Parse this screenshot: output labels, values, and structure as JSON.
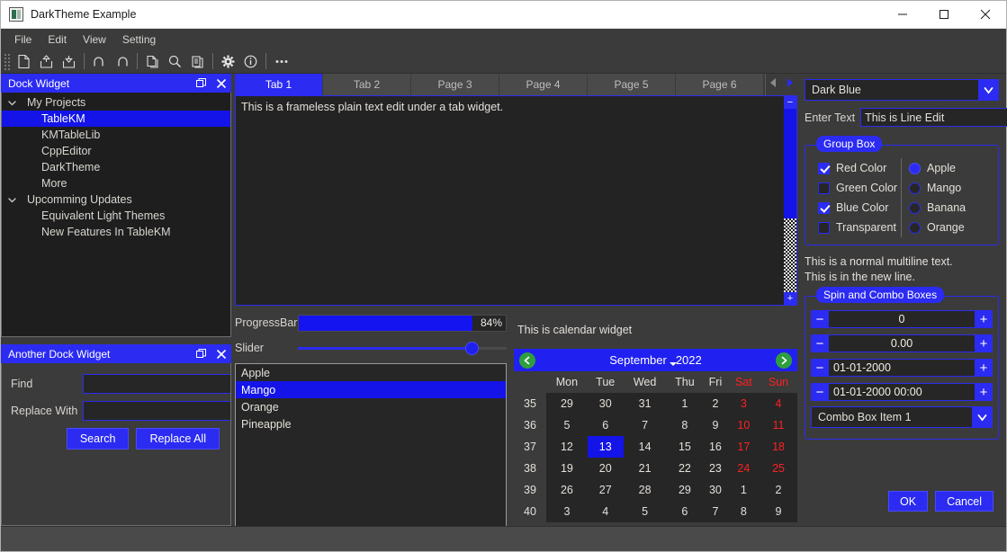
{
  "window": {
    "title": "DarkTheme Example",
    "minimize_label": "minimize",
    "maximize_label": "maximize",
    "close_label": "close"
  },
  "menubar": {
    "items": [
      {
        "label": "File"
      },
      {
        "label": "Edit"
      },
      {
        "label": "View"
      },
      {
        "label": "Setting"
      }
    ]
  },
  "toolbar": {
    "icons": [
      {
        "name": "new-file-icon"
      },
      {
        "name": "upload-icon"
      },
      {
        "name": "download-icon"
      },
      {
        "name": "undo-icon"
      },
      {
        "name": "redo-icon"
      },
      {
        "name": "copy-icon"
      },
      {
        "name": "search-icon"
      },
      {
        "name": "paste-icon"
      },
      {
        "name": "gear-icon"
      },
      {
        "name": "info-icon"
      },
      {
        "name": "overflow-icon",
        "label": "●●●"
      }
    ]
  },
  "dock1": {
    "title": "Dock Widget",
    "tree": [
      {
        "label": "My Projects",
        "level": 0,
        "expanded": true,
        "selected": false
      },
      {
        "label": "TableKM",
        "level": 1,
        "selected": true
      },
      {
        "label": "KMTableLib",
        "level": 1,
        "selected": false
      },
      {
        "label": "CppEditor",
        "level": 1,
        "selected": false
      },
      {
        "label": "DarkTheme",
        "level": 1,
        "selected": false
      },
      {
        "label": "More",
        "level": 1,
        "selected": false
      },
      {
        "label": "Upcomming Updates",
        "level": 0,
        "expanded": true,
        "selected": false
      },
      {
        "label": "Equivalent Light Themes",
        "level": 1,
        "selected": false
      },
      {
        "label": "New Features In TableKM",
        "level": 1,
        "selected": false
      }
    ]
  },
  "dock2": {
    "title": "Another Dock Widget",
    "find_label": "Find",
    "find_value": "",
    "replace_label": "Replace With",
    "replace_value": "",
    "search_button": "Search",
    "replace_all_button": "Replace All"
  },
  "tabs": {
    "items": [
      {
        "label": "Tab 1",
        "active": true
      },
      {
        "label": "Tab 2",
        "active": false
      },
      {
        "label": "Page 3",
        "active": false
      },
      {
        "label": "Page 4",
        "active": false
      },
      {
        "label": "Page 5",
        "active": false
      },
      {
        "label": "Page 6",
        "active": false
      }
    ],
    "nav_prev": "◀",
    "nav_next": "▶"
  },
  "editor": {
    "text": "This is a frameless plain text edit under a tab widget.",
    "scroll_up_label": "−",
    "scroll_down_label": "+"
  },
  "progress": {
    "label": "ProgressBar",
    "value": 84,
    "value_text": "84%"
  },
  "slider": {
    "label": "Slider",
    "value": 83
  },
  "list": {
    "items": [
      {
        "label": "Apple",
        "selected": false
      },
      {
        "label": "Mango",
        "selected": true
      },
      {
        "label": "Orange",
        "selected": false
      },
      {
        "label": "Pineapple",
        "selected": false
      }
    ]
  },
  "calendar": {
    "note": "This is  calendar widget",
    "month": "September",
    "year": "2022",
    "prev_icon": "←",
    "next_icon": "→",
    "week_header": "",
    "day_headers": [
      "Mon",
      "Tue",
      "Wed",
      "Thu",
      "Fri",
      "Sat",
      "Sun"
    ],
    "weekends": [
      "Sat",
      "Sun"
    ],
    "rows": [
      {
        "week": "35",
        "days": [
          "29",
          "30",
          "31",
          "1",
          "2",
          "3",
          "4"
        ]
      },
      {
        "week": "36",
        "days": [
          "5",
          "6",
          "7",
          "8",
          "9",
          "10",
          "11"
        ]
      },
      {
        "week": "37",
        "days": [
          "12",
          "13",
          "14",
          "15",
          "16",
          "17",
          "18"
        ]
      },
      {
        "week": "38",
        "days": [
          "19",
          "20",
          "21",
          "22",
          "23",
          "24",
          "25"
        ]
      },
      {
        "week": "39",
        "days": [
          "26",
          "27",
          "28",
          "29",
          "30",
          "1",
          "2"
        ]
      },
      {
        "week": "40",
        "days": [
          "3",
          "4",
          "5",
          "6",
          "7",
          "8",
          "9"
        ]
      }
    ],
    "selected_day": "13",
    "selected_row": 2,
    "selected_col": 1
  },
  "right": {
    "theme_combo_value": "Dark Blue",
    "enter_text_label": "Enter Text",
    "line_edit_value": "This is Line Edit",
    "groupbox_title": "Group Box",
    "checkboxes": [
      {
        "label": "Red Color",
        "checked": true
      },
      {
        "label": "Green Color",
        "checked": false
      },
      {
        "label": "Blue Color",
        "checked": true
      },
      {
        "label": "Transparent",
        "checked": false
      }
    ],
    "radios": [
      {
        "label": "Apple",
        "checked": true
      },
      {
        "label": "Mango",
        "checked": false
      },
      {
        "label": "Banana",
        "checked": false
      },
      {
        "label": "Orange",
        "checked": false
      }
    ],
    "multiline_line1": "This is a normal multiline text.",
    "multiline_line2": "This is in the new line.",
    "spin_groupbox_title": "Spin and Combo Boxes",
    "spin_minus": "−",
    "spin_plus": "+",
    "spins": [
      {
        "value": "0",
        "align": "center"
      },
      {
        "value": "0.00",
        "align": "center"
      },
      {
        "value": "01-01-2000",
        "align": "left"
      },
      {
        "value": "01-01-2000 00:00",
        "align": "left"
      }
    ],
    "combo_value": "Combo Box Item 1",
    "ok_button": "OK",
    "cancel_button": "Cancel"
  },
  "statusbar": {
    "text": ""
  }
}
